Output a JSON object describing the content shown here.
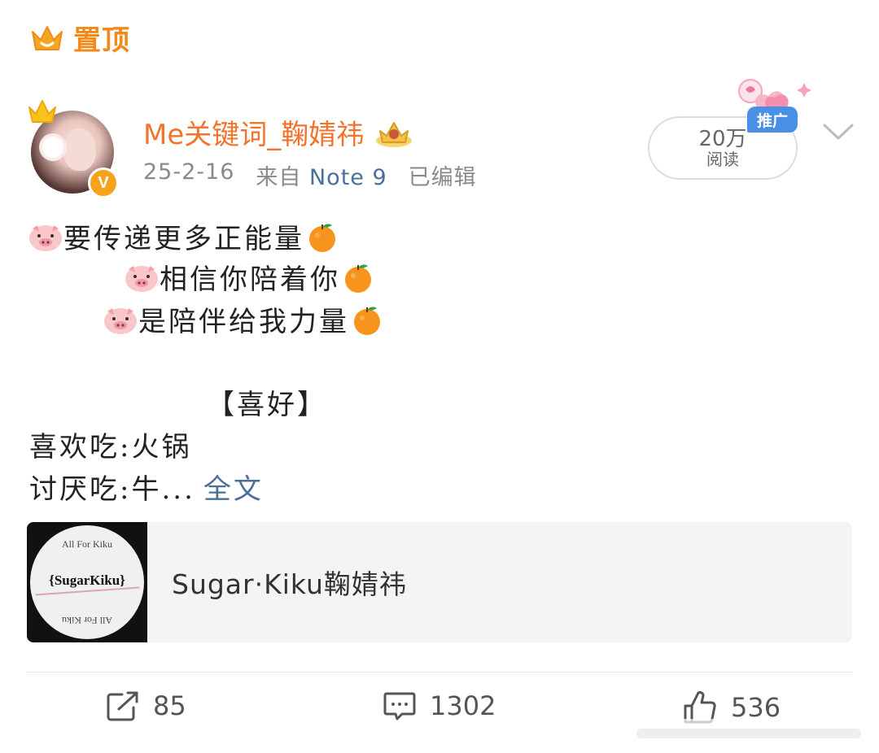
{
  "pinned": {
    "label": "置顶",
    "icon": "crown-icon"
  },
  "author": {
    "name": "Me关键词_鞠婧祎",
    "badge_icon": "crown-badge-icon",
    "verified": "V"
  },
  "meta": {
    "date": "25-2-16",
    "source": "来自",
    "device": "Note 9",
    "edited": "已编辑"
  },
  "reads": {
    "count": "20万",
    "label": "阅读",
    "promo": "推广"
  },
  "post": {
    "line1": "要传递更多正能量",
    "line2": "相信你陪着你",
    "line3": "是陪伴给我力量",
    "section": "【喜好】",
    "line4": "喜欢吃:火锅",
    "line5": "讨厌吃:牛...",
    "full_text_link": "全文"
  },
  "card": {
    "title": "Sugar·Kiku鞠婧祎",
    "thumb_top": "All For Kiku",
    "thumb_name": "{SugarKiku}",
    "thumb_bottom": "All For Kiku"
  },
  "actions": {
    "reposts": "85",
    "comments": "1302",
    "likes": "536"
  },
  "colors": {
    "accent": "#f2742c",
    "link": "#4a6f9b",
    "promo": "#4a8fe7"
  }
}
